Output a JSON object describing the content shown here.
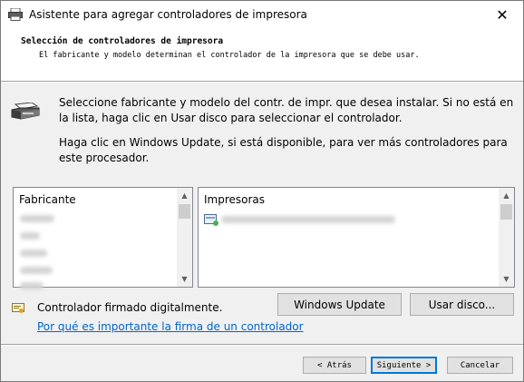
{
  "window": {
    "title": "Asistente para agregar controladores de impresora",
    "close_symbol": "✕"
  },
  "header": {
    "title": "Selección de controladores de impresora",
    "subtitle": "El fabricante y modelo determinan el controlador de la impresora que se debe usar."
  },
  "instructions": {
    "line1": "Seleccione fabricante y modelo del contr. de impr. que desea instalar. Si no está en la lista, haga clic en Usar disco para seleccionar el controlador.",
    "line2": "Haga clic en Windows Update, si está disponible, para ver más controladores para este procesador."
  },
  "manufacturer_list": {
    "header": "Fabricante",
    "items_blurred": 5
  },
  "printer_list": {
    "header": "Impresoras",
    "items_blurred": 1,
    "item_icon": "printer-driver-icon"
  },
  "signed": {
    "text": "Controlador firmado digitalmente.",
    "link": "Por qué es importante la firma de un controlador",
    "icon": "certificate-icon"
  },
  "buttons": {
    "windows_update": "Windows Update",
    "have_disk": "Usar disco...",
    "back": "< Atrás",
    "next": "Siguiente >",
    "cancel": "Cancelar"
  },
  "colors": {
    "accent": "#0078d7",
    "link": "#0066cc"
  }
}
